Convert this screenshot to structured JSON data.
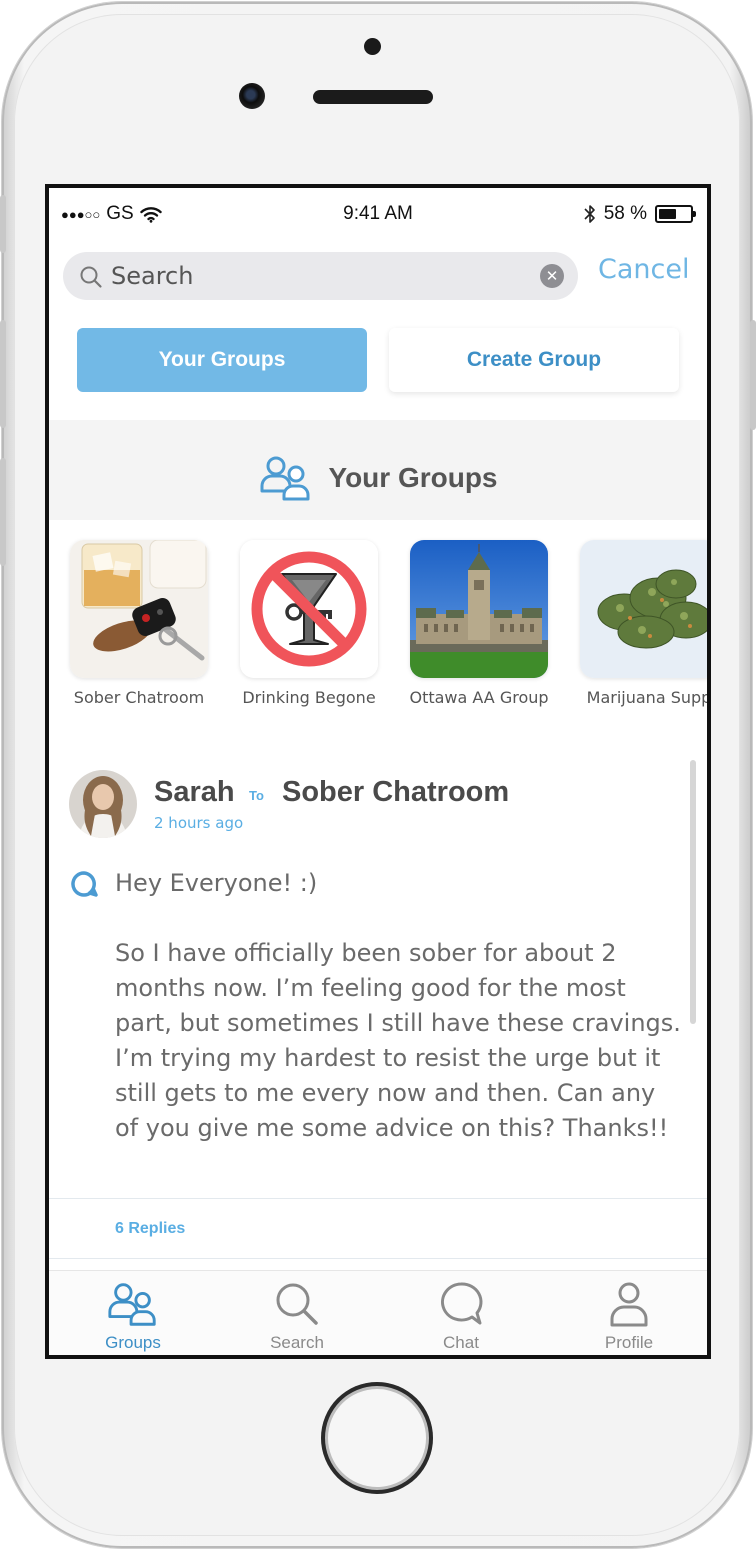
{
  "status_bar": {
    "carrier": "GS",
    "time": "9:41 AM",
    "battery_percent": "58 %",
    "battery_level": 0.58
  },
  "search": {
    "placeholder": "Search",
    "cancel_label": "Cancel"
  },
  "tabs": {
    "your_groups": "Your Groups",
    "create_group": "Create Group"
  },
  "groups_section": {
    "title": "Your Groups",
    "items": [
      {
        "label": "Sober Chatroom"
      },
      {
        "label": "Drinking Begone"
      },
      {
        "label": "Ottawa AA Group"
      },
      {
        "label": "Marijuana Supp"
      }
    ]
  },
  "post": {
    "author": "Sarah",
    "to_label": "To",
    "target_group": "Sober Chatroom",
    "time_ago": "2 hours ago",
    "body": "Hey Everyone! :)\n\nSo I have officially been sober for about 2 months now. I’m feeling good for the most part, but sometimes I still have these cravings. I’m trying my hardest to resist the urge but it still gets to me every now and then. Can any of you give me some advice on this? Thanks!!",
    "replies_label": "6 Replies"
  },
  "tab_bar": {
    "items": [
      {
        "label": "Groups",
        "icon": "groups-icon"
      },
      {
        "label": "Search",
        "icon": "search-icon"
      },
      {
        "label": "Chat",
        "icon": "chat-icon"
      },
      {
        "label": "Profile",
        "icon": "profile-icon"
      }
    ],
    "active": "Groups"
  },
  "colors": {
    "accent": "#72b9e6",
    "link": "#3d8fc6",
    "no_sign": "#f0545a"
  }
}
